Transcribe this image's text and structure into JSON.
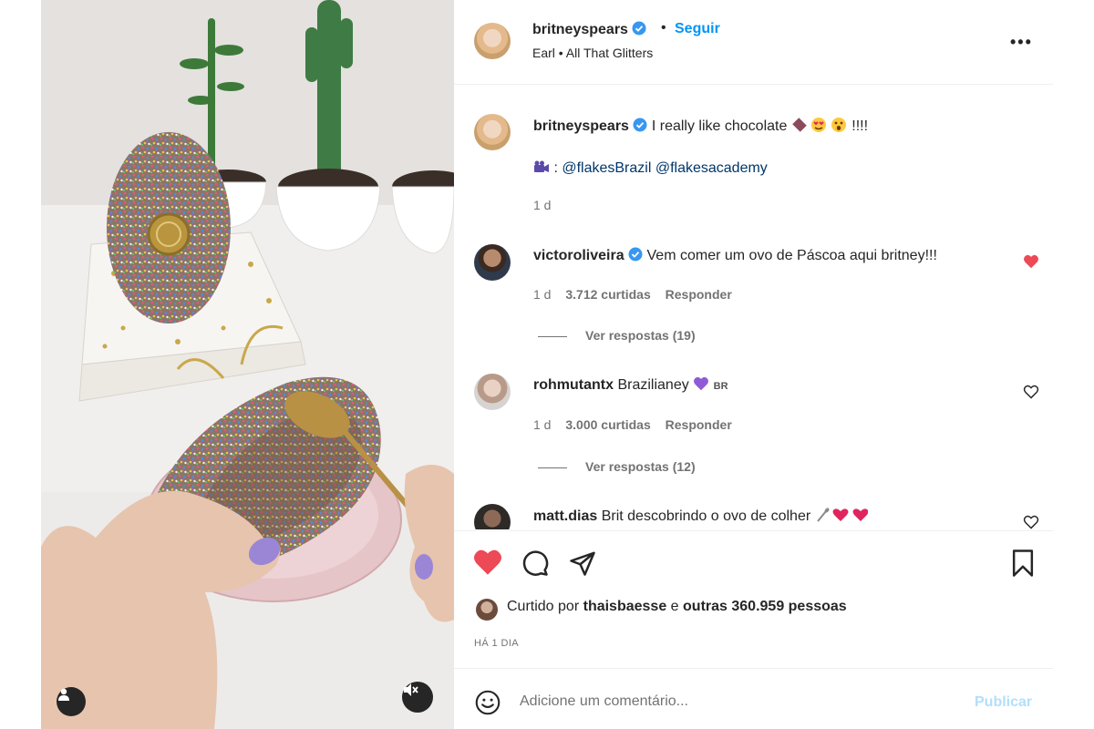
{
  "post": {
    "author": "britneyspears",
    "separator": "•",
    "follow_label": "Seguir",
    "music": "Earl • All That Glitters",
    "more_label": "•••"
  },
  "caption": {
    "user": "britneyspears",
    "text": "I really like chocolate",
    "emojis": "!!!!",
    "credit_prefix": ": ",
    "credit_handles": "@flakesBrazil @flakesacademy",
    "time": "1 d"
  },
  "comments": [
    {
      "user": "victoroliveira",
      "text": "Vem comer um ovo de Páscoa aqui britney!!!",
      "time": "1 d",
      "likes": "3.712 curtidas",
      "reply_label": "Responder",
      "view_replies": "Ver respostas (19)",
      "liked": true
    },
    {
      "user": "rohmutantx",
      "text": "Brazilianey",
      "badge": "BR",
      "time": "1 d",
      "likes": "3.000 curtidas",
      "reply_label": "Responder",
      "view_replies": "Ver respostas (12)",
      "liked": false
    },
    {
      "user": "matt.dias",
      "text": "Brit descobrindo o ovo de colher",
      "liked": false
    }
  ],
  "likes": {
    "prefix": "Curtido por",
    "user": "thaisbaesse",
    "middle": "e",
    "others": "outras 360.959 pessoas"
  },
  "timestamp": "HÁ 1 DIA",
  "composer": {
    "placeholder": "Adicione um comentário...",
    "publish_label": "Publicar"
  },
  "colors": {
    "accent": "#0095f6",
    "like_red": "#ed4956",
    "muted_text": "#737373",
    "publish_disabled": "#b2dffc",
    "verified": "#3897f0"
  },
  "icons": [
    "verified-icon",
    "more-icon",
    "heart-icon",
    "comment-icon",
    "share-icon",
    "bookmark-icon",
    "emoji-icon",
    "user-tag-icon",
    "mute-icon",
    "purple-heart-icon",
    "camera-icon"
  ]
}
